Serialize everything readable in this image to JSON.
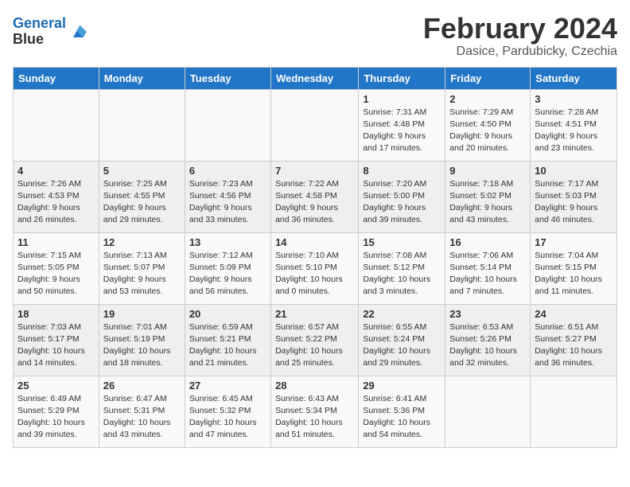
{
  "logo": {
    "line1": "General",
    "line2": "Blue"
  },
  "title": "February 2024",
  "subtitle": "Dasice, Pardubicky, Czechia",
  "headers": [
    "Sunday",
    "Monday",
    "Tuesday",
    "Wednesday",
    "Thursday",
    "Friday",
    "Saturday"
  ],
  "weeks": [
    [
      {
        "day": "",
        "info": ""
      },
      {
        "day": "",
        "info": ""
      },
      {
        "day": "",
        "info": ""
      },
      {
        "day": "",
        "info": ""
      },
      {
        "day": "1",
        "info": "Sunrise: 7:31 AM\nSunset: 4:48 PM\nDaylight: 9 hours\nand 17 minutes."
      },
      {
        "day": "2",
        "info": "Sunrise: 7:29 AM\nSunset: 4:50 PM\nDaylight: 9 hours\nand 20 minutes."
      },
      {
        "day": "3",
        "info": "Sunrise: 7:28 AM\nSunset: 4:51 PM\nDaylight: 9 hours\nand 23 minutes."
      }
    ],
    [
      {
        "day": "4",
        "info": "Sunrise: 7:26 AM\nSunset: 4:53 PM\nDaylight: 9 hours\nand 26 minutes."
      },
      {
        "day": "5",
        "info": "Sunrise: 7:25 AM\nSunset: 4:55 PM\nDaylight: 9 hours\nand 29 minutes."
      },
      {
        "day": "6",
        "info": "Sunrise: 7:23 AM\nSunset: 4:56 PM\nDaylight: 9 hours\nand 33 minutes."
      },
      {
        "day": "7",
        "info": "Sunrise: 7:22 AM\nSunset: 4:58 PM\nDaylight: 9 hours\nand 36 minutes."
      },
      {
        "day": "8",
        "info": "Sunrise: 7:20 AM\nSunset: 5:00 PM\nDaylight: 9 hours\nand 39 minutes."
      },
      {
        "day": "9",
        "info": "Sunrise: 7:18 AM\nSunset: 5:02 PM\nDaylight: 9 hours\nand 43 minutes."
      },
      {
        "day": "10",
        "info": "Sunrise: 7:17 AM\nSunset: 5:03 PM\nDaylight: 9 hours\nand 46 minutes."
      }
    ],
    [
      {
        "day": "11",
        "info": "Sunrise: 7:15 AM\nSunset: 5:05 PM\nDaylight: 9 hours\nand 50 minutes."
      },
      {
        "day": "12",
        "info": "Sunrise: 7:13 AM\nSunset: 5:07 PM\nDaylight: 9 hours\nand 53 minutes."
      },
      {
        "day": "13",
        "info": "Sunrise: 7:12 AM\nSunset: 5:09 PM\nDaylight: 9 hours\nand 56 minutes."
      },
      {
        "day": "14",
        "info": "Sunrise: 7:10 AM\nSunset: 5:10 PM\nDaylight: 10 hours\nand 0 minutes."
      },
      {
        "day": "15",
        "info": "Sunrise: 7:08 AM\nSunset: 5:12 PM\nDaylight: 10 hours\nand 3 minutes."
      },
      {
        "day": "16",
        "info": "Sunrise: 7:06 AM\nSunset: 5:14 PM\nDaylight: 10 hours\nand 7 minutes."
      },
      {
        "day": "17",
        "info": "Sunrise: 7:04 AM\nSunset: 5:15 PM\nDaylight: 10 hours\nand 11 minutes."
      }
    ],
    [
      {
        "day": "18",
        "info": "Sunrise: 7:03 AM\nSunset: 5:17 PM\nDaylight: 10 hours\nand 14 minutes."
      },
      {
        "day": "19",
        "info": "Sunrise: 7:01 AM\nSunset: 5:19 PM\nDaylight: 10 hours\nand 18 minutes."
      },
      {
        "day": "20",
        "info": "Sunrise: 6:59 AM\nSunset: 5:21 PM\nDaylight: 10 hours\nand 21 minutes."
      },
      {
        "day": "21",
        "info": "Sunrise: 6:57 AM\nSunset: 5:22 PM\nDaylight: 10 hours\nand 25 minutes."
      },
      {
        "day": "22",
        "info": "Sunrise: 6:55 AM\nSunset: 5:24 PM\nDaylight: 10 hours\nand 29 minutes."
      },
      {
        "day": "23",
        "info": "Sunrise: 6:53 AM\nSunset: 5:26 PM\nDaylight: 10 hours\nand 32 minutes."
      },
      {
        "day": "24",
        "info": "Sunrise: 6:51 AM\nSunset: 5:27 PM\nDaylight: 10 hours\nand 36 minutes."
      }
    ],
    [
      {
        "day": "25",
        "info": "Sunrise: 6:49 AM\nSunset: 5:29 PM\nDaylight: 10 hours\nand 39 minutes."
      },
      {
        "day": "26",
        "info": "Sunrise: 6:47 AM\nSunset: 5:31 PM\nDaylight: 10 hours\nand 43 minutes."
      },
      {
        "day": "27",
        "info": "Sunrise: 6:45 AM\nSunset: 5:32 PM\nDaylight: 10 hours\nand 47 minutes."
      },
      {
        "day": "28",
        "info": "Sunrise: 6:43 AM\nSunset: 5:34 PM\nDaylight: 10 hours\nand 51 minutes."
      },
      {
        "day": "29",
        "info": "Sunrise: 6:41 AM\nSunset: 5:36 PM\nDaylight: 10 hours\nand 54 minutes."
      },
      {
        "day": "",
        "info": ""
      },
      {
        "day": "",
        "info": ""
      }
    ]
  ]
}
